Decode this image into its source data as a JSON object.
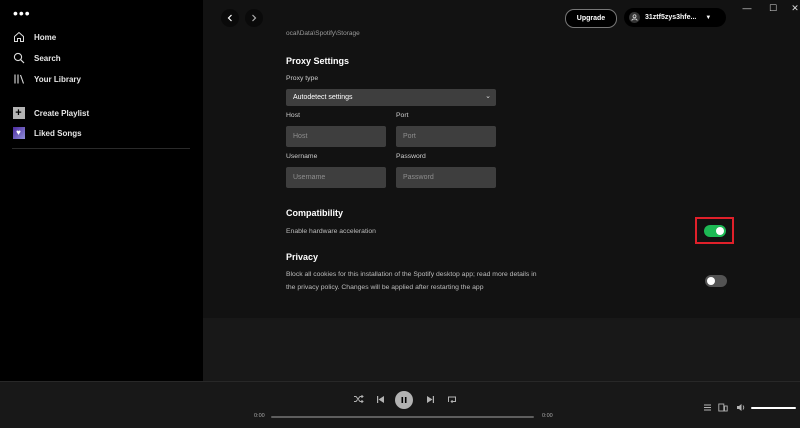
{
  "window": {
    "minimize_glyph": "—",
    "maximize_glyph": "☐",
    "close_glyph": "✕"
  },
  "sidebar": {
    "menu_dots": "•••",
    "items": [
      {
        "label": "Home",
        "icon": "home-icon"
      },
      {
        "label": "Search",
        "icon": "search-icon"
      },
      {
        "label": "Your Library",
        "icon": "library-icon"
      }
    ],
    "actions": [
      {
        "label": "Create Playlist",
        "icon": "plus-icon"
      },
      {
        "label": "Liked Songs",
        "icon": "heart-icon"
      }
    ]
  },
  "topbar": {
    "upgrade_label": "Upgrade",
    "username": "31ztf5zys3hfe..."
  },
  "settings": {
    "storage_path": "ocal\\Data\\Spotify\\Storage",
    "proxy": {
      "title": "Proxy Settings",
      "type_label": "Proxy type",
      "type_value": "Autodetect settings",
      "host_label": "Host",
      "host_placeholder": "Host",
      "port_label": "Port",
      "port_placeholder": "Port",
      "username_label": "Username",
      "username_placeholder": "Username",
      "password_label": "Password",
      "password_placeholder": "Password"
    },
    "compatibility": {
      "title": "Compatibility",
      "hw_accel_label": "Enable hardware acceleration",
      "hw_accel_enabled": true
    },
    "privacy": {
      "title": "Privacy",
      "cookies_line1": "Block all cookies for this installation of the Spotify desktop app; read more details in",
      "cookies_line2": "the privacy policy. Changes will be applied after restarting the app",
      "cookies_enabled": false
    }
  },
  "player": {
    "elapsed": "0:00",
    "duration": "0:00",
    "progress": 0,
    "volume": 1
  },
  "colors": {
    "accent_green": "#1db954",
    "highlight_red": "#e0202a"
  }
}
